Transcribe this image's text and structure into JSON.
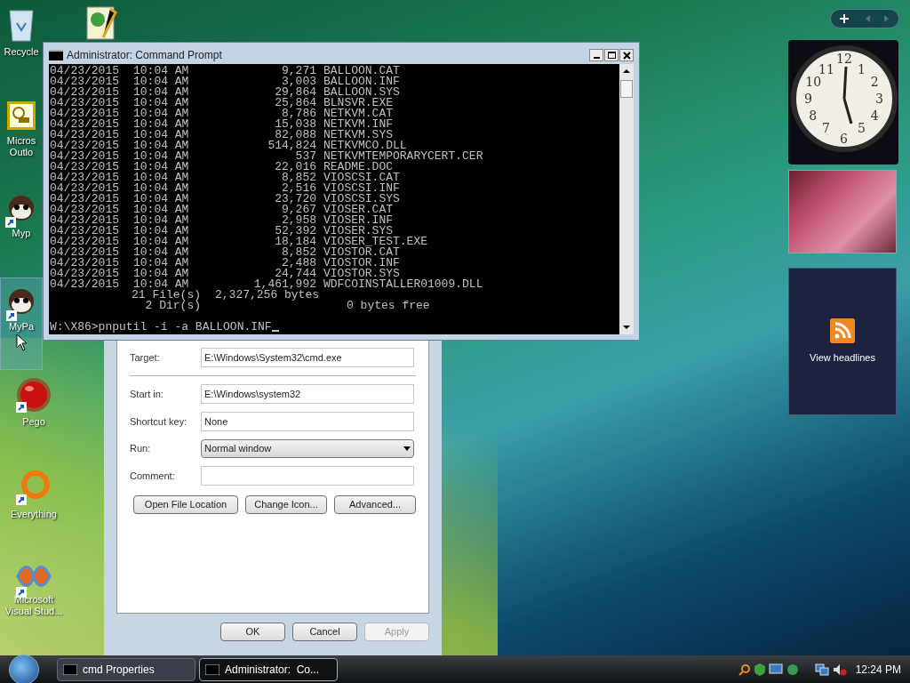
{
  "desktop_icons": [
    {
      "kind": "recycle",
      "label": "Recycle",
      "shortcut": false,
      "selected": false
    },
    {
      "kind": "outlook",
      "label": "Micros Outlo",
      "shortcut": false,
      "selected": false
    },
    {
      "kind": "pet",
      "label": "Myp",
      "shortcut": true,
      "selected": false
    },
    {
      "kind": "pet",
      "label": "MyPa",
      "shortcut": true,
      "selected": true
    },
    {
      "kind": "pego",
      "label": "Pego",
      "shortcut": true,
      "selected": false
    },
    {
      "kind": "ring",
      "label": "Everything",
      "shortcut": true,
      "selected": false
    },
    {
      "kind": "studio",
      "label": "Microsoft Visual Stud...",
      "shortcut": true,
      "selected": false
    }
  ],
  "cmd_window": {
    "title": "Administrator: Command Prompt",
    "rows": [
      {
        "date": "04/23/2015",
        "time": "10:04 AM",
        "size": "9,271",
        "name": "BALLOON.CAT"
      },
      {
        "date": "04/23/2015",
        "time": "10:04 AM",
        "size": "3,003",
        "name": "BALLOON.INF"
      },
      {
        "date": "04/23/2015",
        "time": "10:04 AM",
        "size": "29,864",
        "name": "BALLOON.SYS"
      },
      {
        "date": "04/23/2015",
        "time": "10:04 AM",
        "size": "25,864",
        "name": "BLNSVR.EXE"
      },
      {
        "date": "04/23/2015",
        "time": "10:04 AM",
        "size": "8,786",
        "name": "NETKVM.CAT"
      },
      {
        "date": "04/23/2015",
        "time": "10:04 AM",
        "size": "15,038",
        "name": "NETKVM.INF"
      },
      {
        "date": "04/23/2015",
        "time": "10:04 AM",
        "size": "82,088",
        "name": "NETKVM.SYS"
      },
      {
        "date": "04/23/2015",
        "time": "10:04 AM",
        "size": "514,824",
        "name": "NETKVMCO.DLL"
      },
      {
        "date": "04/23/2015",
        "time": "10:04 AM",
        "size": "537",
        "name": "NETKVMTEMPORARYCERT.CER"
      },
      {
        "date": "04/23/2015",
        "time": "10:04 AM",
        "size": "22,016",
        "name": "README.DOC"
      },
      {
        "date": "04/23/2015",
        "time": "10:04 AM",
        "size": "8,852",
        "name": "VIOSCSI.CAT"
      },
      {
        "date": "04/23/2015",
        "time": "10:04 AM",
        "size": "2,516",
        "name": "VIOSCSI.INF"
      },
      {
        "date": "04/23/2015",
        "time": "10:04 AM",
        "size": "23,720",
        "name": "VIOSCSI.SYS"
      },
      {
        "date": "04/23/2015",
        "time": "10:04 AM",
        "size": "9,267",
        "name": "VIOSER.CAT"
      },
      {
        "date": "04/23/2015",
        "time": "10:04 AM",
        "size": "2,958",
        "name": "VIOSER.INF"
      },
      {
        "date": "04/23/2015",
        "time": "10:04 AM",
        "size": "52,392",
        "name": "VIOSER.SYS"
      },
      {
        "date": "04/23/2015",
        "time": "10:04 AM",
        "size": "18,184",
        "name": "VIOSER_TEST.EXE"
      },
      {
        "date": "04/23/2015",
        "time": "10:04 AM",
        "size": "8,852",
        "name": "VIOSTOR.CAT"
      },
      {
        "date": "04/23/2015",
        "time": "10:04 AM",
        "size": "2,488",
        "name": "VIOSTOR.INF"
      },
      {
        "date": "04/23/2015",
        "time": "10:04 AM",
        "size": "24,744",
        "name": "VIOSTOR.SYS"
      },
      {
        "date": "04/23/2015",
        "time": "10:04 AM",
        "size": "1,461,992",
        "name": "WDFCOINSTALLER01009.DLL"
      }
    ],
    "summary": [
      {
        "count": "21 File(s)",
        "amount": "2,327,256 bytes"
      },
      {
        "count": "2 Dir(s)",
        "amount": "0 bytes free"
      }
    ],
    "prompt": "W:\\X86>pnputil -i -a BALLOON.INF"
  },
  "properties_dialog": {
    "fields": [
      {
        "kind": "text",
        "label": "Target:",
        "value": "E:\\Windows\\System32\\cmd.exe"
      },
      {
        "kind": "separator"
      },
      {
        "kind": "text",
        "label": "Start in:",
        "value": "E:\\Windows\\system32"
      },
      {
        "kind": "text",
        "label": "Shortcut key:",
        "value": "None"
      },
      {
        "kind": "select",
        "label": "Run:",
        "value": "Normal window"
      },
      {
        "kind": "text",
        "label": "Comment:"
      }
    ],
    "actions": [
      "Open File Location",
      "Change Icon...",
      "Advanced..."
    ],
    "buttons": [
      {
        "label": "OK",
        "disabled": false
      },
      {
        "label": "Cancel",
        "disabled": false
      },
      {
        "label": "Apply",
        "disabled": true
      }
    ]
  },
  "sidebar": {
    "clock_numerals": [
      "12",
      "11",
      "1",
      "10",
      "2",
      "9",
      "3",
      "8",
      "4",
      "7",
      "5",
      "6"
    ],
    "feed_label": "View headlines"
  },
  "taskbar": {
    "tasks": [
      {
        "label": "cmd Properties",
        "selected": false
      },
      {
        "label": "Administrator:  Co...",
        "selected": true
      }
    ],
    "time": "12:24 PM"
  }
}
